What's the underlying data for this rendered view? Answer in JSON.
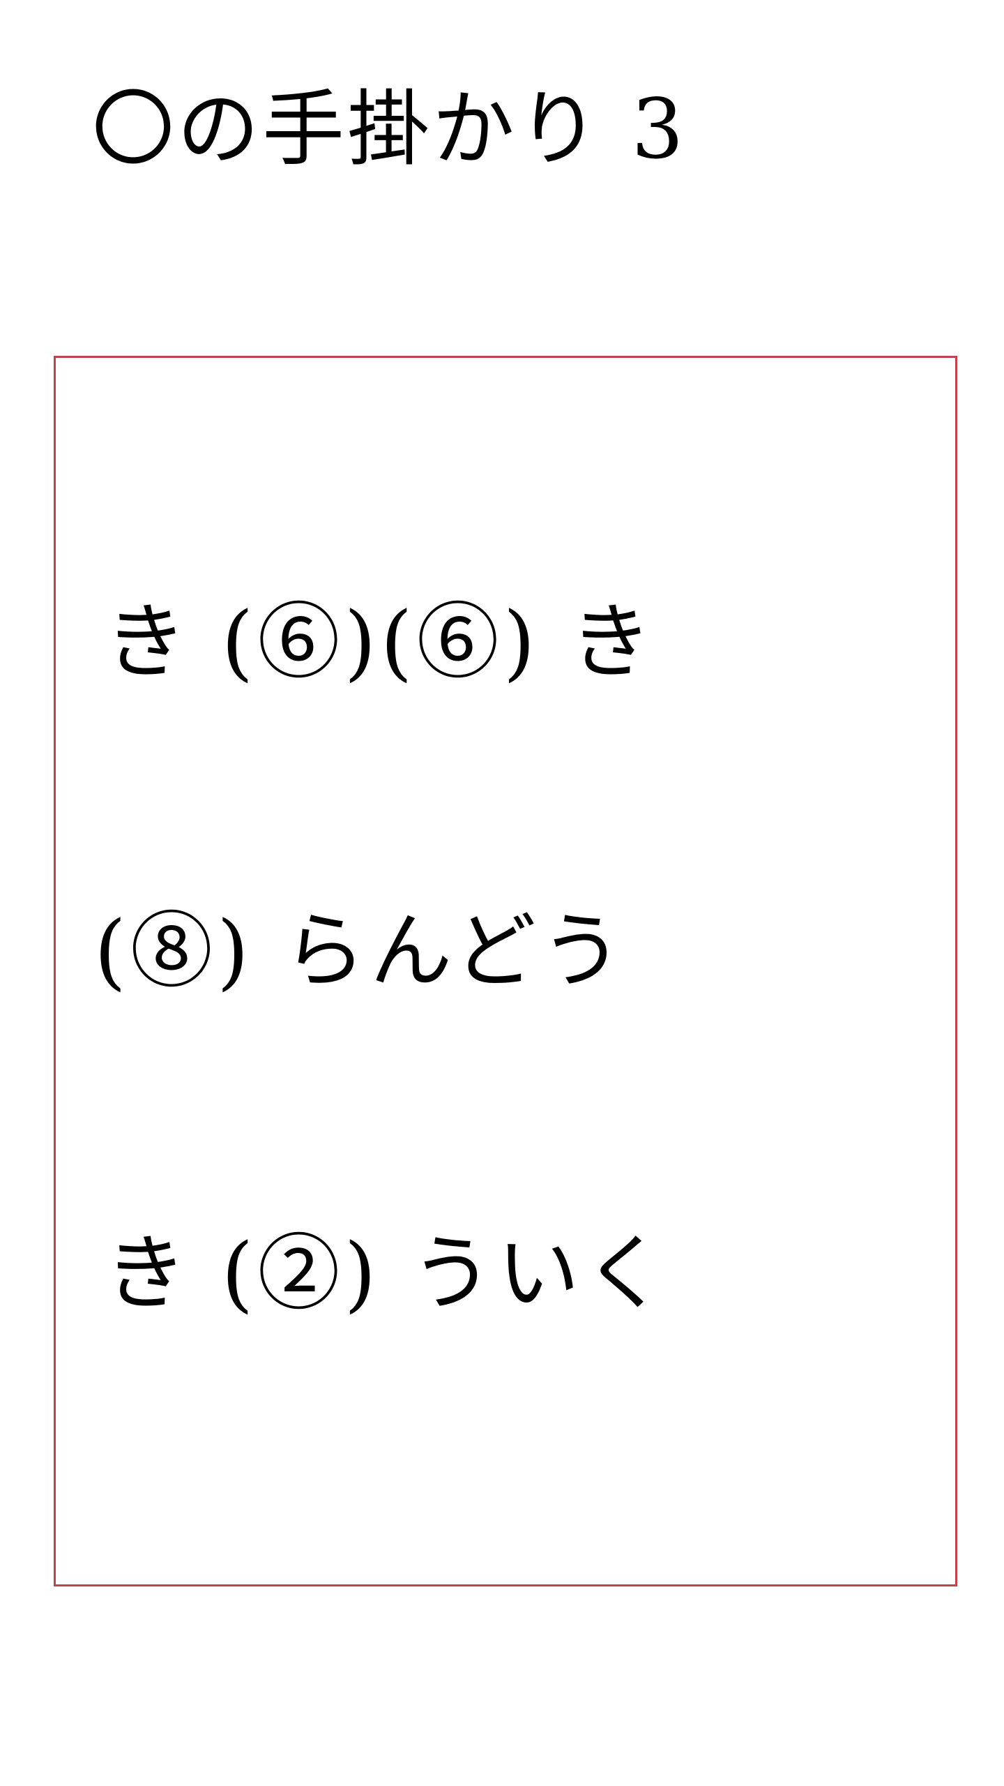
{
  "title": "〇の手掛かり 3",
  "clue_lines": [
    "き (⑥)(⑥) き",
    "(⑧) らんどう",
    "き (②) ういく"
  ],
  "colors": {
    "box_border": "#c0424c",
    "text": "#000000",
    "background": "#ffffff"
  }
}
